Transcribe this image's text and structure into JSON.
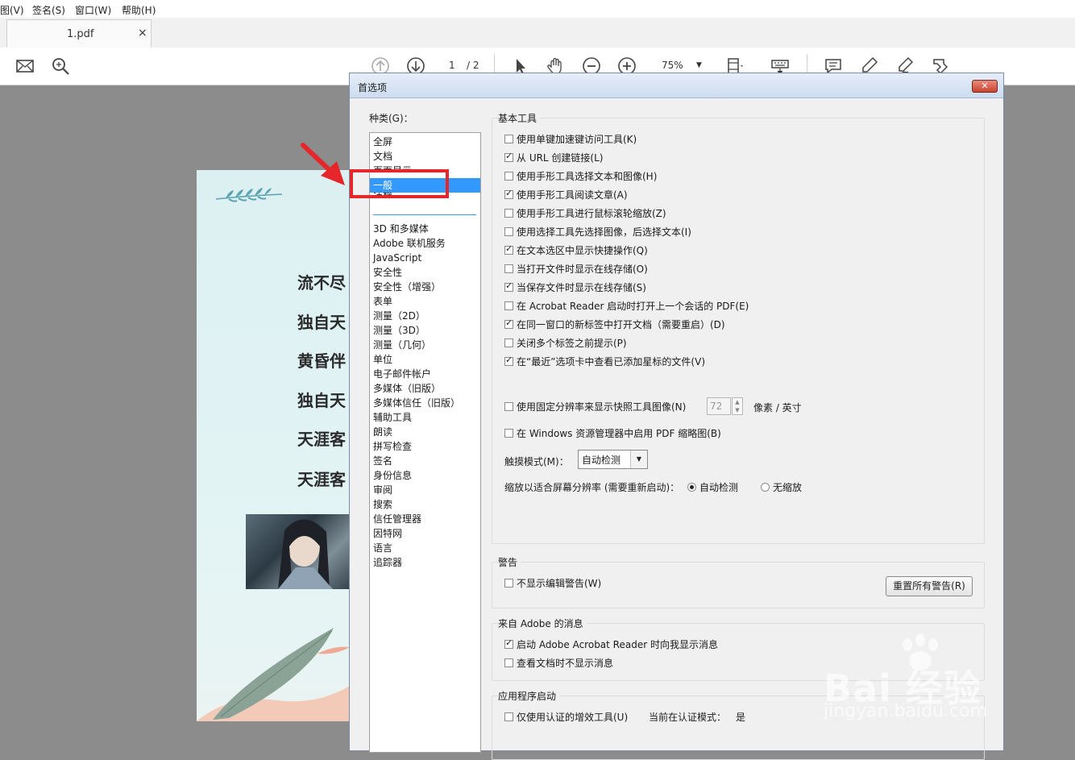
{
  "menu": [
    "图(V)",
    "签名(S)",
    "窗口(W)",
    "帮助(H)"
  ],
  "tab": {
    "label": "1.pdf",
    "close": "×"
  },
  "toolbar": {
    "page_current": "1",
    "page_total": "/ 2",
    "zoom": "75%"
  },
  "pdf": {
    "lines": [
      "流不尽",
      "独自天",
      "黄昏伴",
      "独自天",
      "天涯客",
      "天涯客"
    ]
  },
  "dialog": {
    "title": "首选项",
    "close": "✕",
    "category_label": "种类(G)：",
    "categories": [
      "全屏",
      "文档",
      "页面显示",
      "一般",
      "注释",
      "3D 和多媒体",
      "Adobe 联机服务",
      "JavaScript",
      "安全性",
      "安全性（增强）",
      "表单",
      "测量（2D）",
      "测量（3D）",
      "测量（几何）",
      "单位",
      "电子邮件帐户",
      "多媒体（旧版）",
      "多媒体信任（旧版）",
      "辅助工具",
      "朗读",
      "拼写检查",
      "签名",
      "身份信息",
      "审阅",
      "搜索",
      "信任管理器",
      "因特网",
      "语言",
      "追踪器"
    ],
    "selected_category": "一般",
    "basic_tools": {
      "title": "基本工具",
      "options": [
        {
          "label": "使用单键加速键访问工具(K)",
          "checked": false
        },
        {
          "label": "从 URL 创建链接(L)",
          "checked": true
        },
        {
          "label": "使用手形工具选择文本和图像(H)",
          "checked": false
        },
        {
          "label": "使用手形工具阅读文章(A)",
          "checked": true
        },
        {
          "label": "使用手形工具进行鼠标滚轮缩放(Z)",
          "checked": false
        },
        {
          "label": "使用选择工具先选择图像，后选择文本(I)",
          "checked": false
        },
        {
          "label": "在文本选区中显示快捷操作(Q)",
          "checked": true
        },
        {
          "label": "当打开文件时显示在线存储(O)",
          "checked": false
        },
        {
          "label": "当保存文件时显示在线存储(S)",
          "checked": true
        },
        {
          "label": "在 Acrobat Reader 启动时打开上一个会话的 PDF(E)",
          "checked": false
        },
        {
          "label": "在同一窗口的新标签中打开文档（需要重启）(D)",
          "checked": true
        },
        {
          "label": "关闭多个标签之前提示(P)",
          "checked": false
        },
        {
          "label": "在“最近”选项卡中查看已添加星标的文件(V)",
          "checked": true
        }
      ],
      "fixed_res": {
        "label": "使用固定分辨率来显示快照工具图像(N)",
        "checked": false,
        "value": "72",
        "unit": "像素 / 英寸"
      },
      "thumbnails": {
        "label": "在 Windows 资源管理器中启用 PDF 缩略图(B)",
        "checked": false
      },
      "touch_mode": {
        "label": "触摸模式(M)：",
        "value": "自动检测"
      },
      "scale": {
        "label": "缩放以适合屏幕分辨率 (需要重新启动)：",
        "auto": "自动检测",
        "none": "无缩放",
        "selected": "auto"
      }
    },
    "warnings": {
      "title": "警告",
      "no_edit_warning": {
        "label": "不显示编辑警告(W)",
        "checked": false
      },
      "reset_button": "重置所有警告(R)"
    },
    "adobe_messages": {
      "title": "来自 Adobe 的消息",
      "options": [
        {
          "label": "启动 Adobe Acrobat Reader 时向我显示消息",
          "checked": true
        },
        {
          "label": "查看文档时不显示消息",
          "checked": false
        }
      ]
    },
    "app_startup": {
      "title": "应用程序启动",
      "certified_only": {
        "label": "仅使用认证的增效工具(U)",
        "checked": false
      },
      "cert_mode_label": "当前在认证模式：",
      "cert_mode_value": "是"
    }
  },
  "watermark": {
    "logo": "Bai 经验",
    "url": "jingyan.baidu.com"
  },
  "colors": {
    "selection": "#3399ff",
    "annotation_red": "#e5262b"
  }
}
